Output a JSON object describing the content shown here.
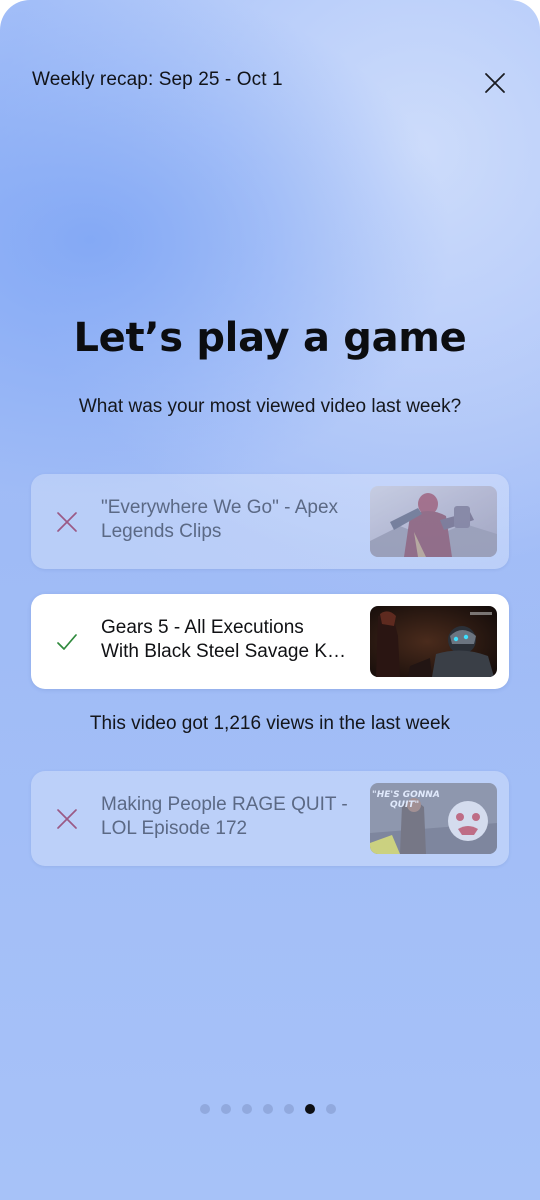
{
  "header": {
    "title": "Weekly recap: Sep 25 - Oct 1"
  },
  "game": {
    "title": "Let’s play a game",
    "question": "What was your most viewed video last week?"
  },
  "options": [
    {
      "line1": "\"Everywhere We Go\" - Apex",
      "line2": "Legends Clips",
      "state": "incorrect",
      "mark_icon": "x-mark-icon"
    },
    {
      "line1": "Gears 5 - All Executions",
      "line2": "With Black Steel Savage K…",
      "state": "correct",
      "mark_icon": "checkmark-icon"
    },
    {
      "line1": "Making People RAGE QUIT -",
      "line2": "LOL Episode 172",
      "state": "incorrect",
      "mark_icon": "x-mark-icon",
      "thumb_text_1": "\"HE'S GONNA",
      "thumb_text_2": "QUIT\""
    }
  ],
  "result_note": "This video got 1,216 views in the last week",
  "pager": {
    "total": 7,
    "active_index": 5
  },
  "colors": {
    "incorrect_mark": "#9b5a86",
    "correct_mark": "#2f8a3d",
    "active_dot": "#0d0f14"
  }
}
